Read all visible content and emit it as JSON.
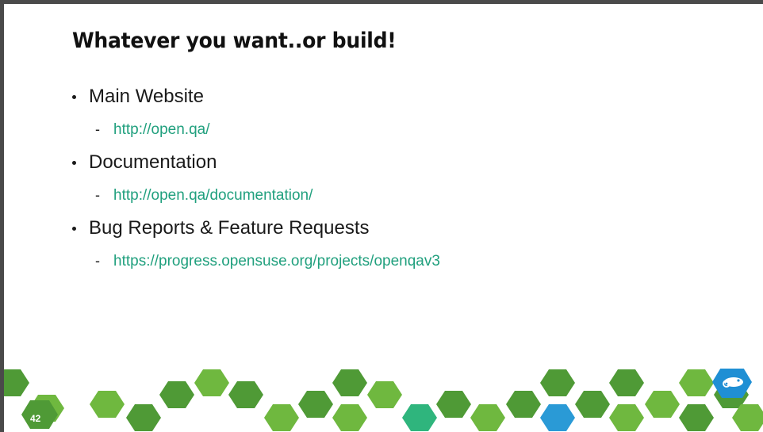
{
  "slide": {
    "title": "Whatever you want..or build!",
    "page_number": "42",
    "items": [
      {
        "label": "Main Website",
        "link": "http://open.qa/"
      },
      {
        "label": "Documentation",
        "link": "http://open.qa/documentation/"
      },
      {
        "label": "Bug Reports & Feature Requests",
        "link": "https://progress.opensuse.org/projects/openqav3"
      }
    ]
  },
  "colors": {
    "link": "#21a07e",
    "hex_dark_green": "#4f9a36",
    "hex_light_green": "#6fb83f",
    "hex_teal": "#2fb57d",
    "hex_blue": "#2a9ad6",
    "logo_blue": "#1f8fd4"
  },
  "icons": {
    "logo": "opensuse-chameleon-icon",
    "decoration": "hexagon-pattern"
  }
}
